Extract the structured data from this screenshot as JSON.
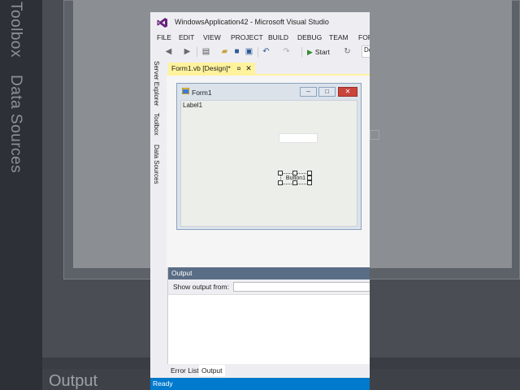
{
  "background": {
    "side_tabs": [
      "Toolbox",
      "Data Sources"
    ],
    "output_label": "Output"
  },
  "window": {
    "title": "WindowsApplication42 - Microsoft Visual Studio"
  },
  "menu": [
    "FILE",
    "EDIT",
    "VIEW",
    "PROJECT",
    "BUILD",
    "DEBUG",
    "TEAM",
    "FOR"
  ],
  "toolbar": {
    "start_label": "Start",
    "config_value": "De"
  },
  "side_tabs": [
    "Server Explorer",
    "Toolbox",
    "Data Sources"
  ],
  "document_tab": {
    "label": "Form1.vb [Design]*",
    "pin": "¤",
    "close": "✕"
  },
  "form": {
    "title": "Form1",
    "label_text": "Label1",
    "button_text": "Button1"
  },
  "output_panel": {
    "title": "Output",
    "show_output_label": "Show output from:"
  },
  "bottom_tabs": [
    "Error List",
    "Output"
  ],
  "status": "Ready",
  "colors": {
    "accent": "#007acc",
    "tab_highlight": "#fff29d",
    "panel_header": "#5a6d86"
  }
}
